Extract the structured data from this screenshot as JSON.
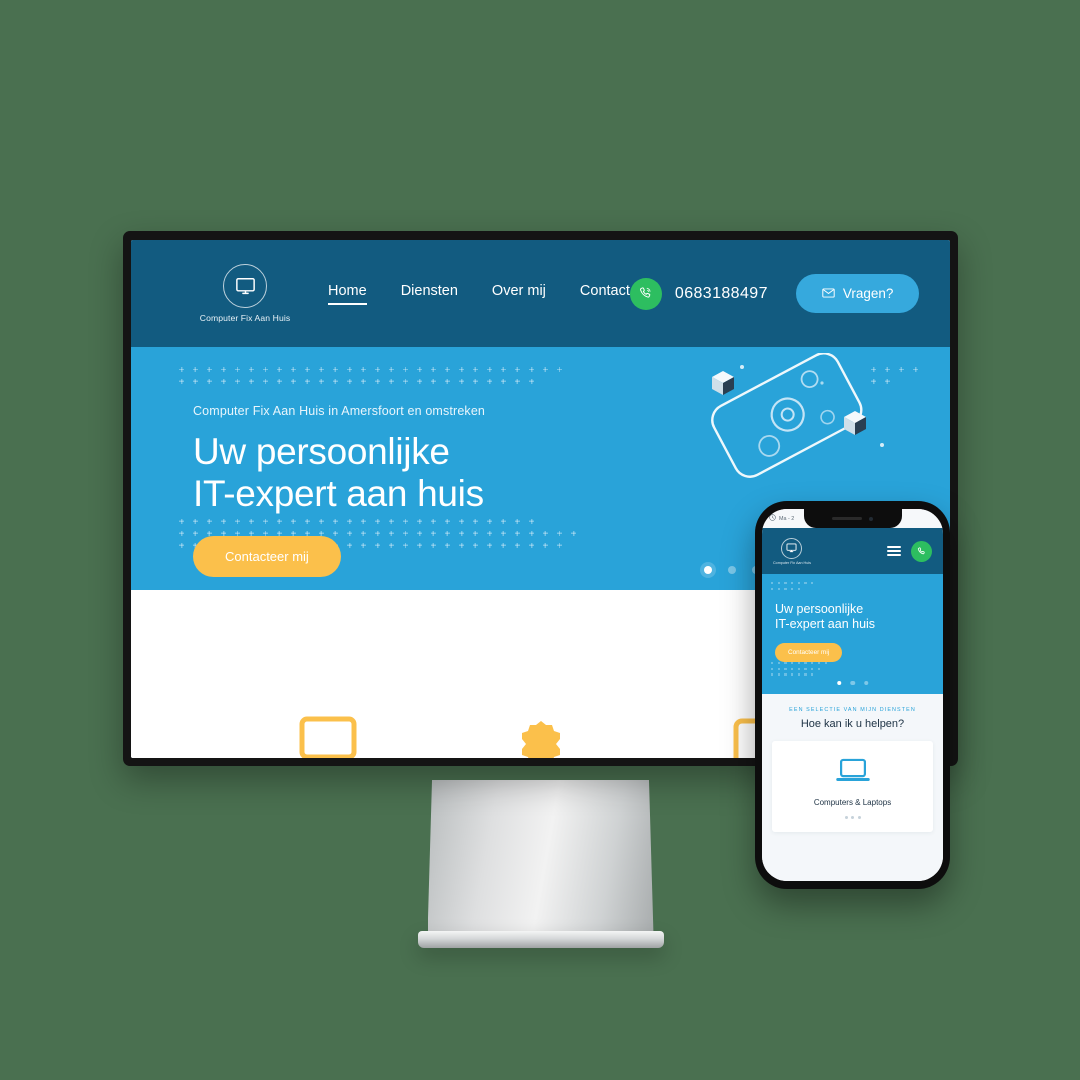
{
  "theme": {
    "page_background": "#4a7050",
    "header_blue": "#125b80",
    "hero_blue": "#29a3d9",
    "accent_yellow": "#fbc04b",
    "whatsapp_green": "#2dbe60",
    "button_blue": "#36a9dd",
    "heading_navy": "#1d3244"
  },
  "desktop": {
    "brand": {
      "name": "Computer Fix Aan Huis",
      "logo_icon": "monitor-icon"
    },
    "nav": [
      {
        "label": "Home",
        "active": true
      },
      {
        "label": "Diensten",
        "active": false
      },
      {
        "label": "Over mij",
        "active": false
      },
      {
        "label": "Contact",
        "active": false
      }
    ],
    "contact": {
      "phone_icon": "whatsapp-phone-icon",
      "phone_number": "0683188497",
      "cta_icon": "envelope-icon",
      "cta_label": "Vragen?"
    },
    "hero": {
      "eyebrow": "Computer Fix Aan Huis in Amersfoort en omstreken",
      "title_line1": "Uw persoonlijke",
      "title_line2": "IT-expert aan huis",
      "cta_label": "Contacteer mij",
      "carousel": {
        "total": 3,
        "active_index": 0
      },
      "illustration": "tilted-phone-with-gears-and-cubes-illustration"
    },
    "services_strip": [
      {
        "icon": "monitor-outline-icon"
      },
      {
        "icon": "gear-icon"
      },
      {
        "icon": "phone-outline-icon"
      }
    ]
  },
  "phone": {
    "statusbar": {
      "clock_icon": "clock-icon",
      "text": "Ma - 2"
    },
    "brand": {
      "name": "Computer Fix Aan Huis",
      "logo_icon": "monitor-icon"
    },
    "header_actions": {
      "menu_icon": "hamburger-menu-icon",
      "call_icon": "whatsapp-phone-icon"
    },
    "hero": {
      "title_line1": "Uw persoonlijke",
      "title_line2": "IT-expert aan huis",
      "cta_label": "Contacteer mij",
      "carousel": {
        "total": 3,
        "active_index": 0
      }
    },
    "services": {
      "eyebrow": "EEN SELECTIE VAN MIJN DIENSTEN",
      "title": "Hoe kan ik u helpen?",
      "card": {
        "icon": "laptop-icon",
        "label": "Computers & Laptops"
      },
      "pagination_dots": 3
    }
  }
}
